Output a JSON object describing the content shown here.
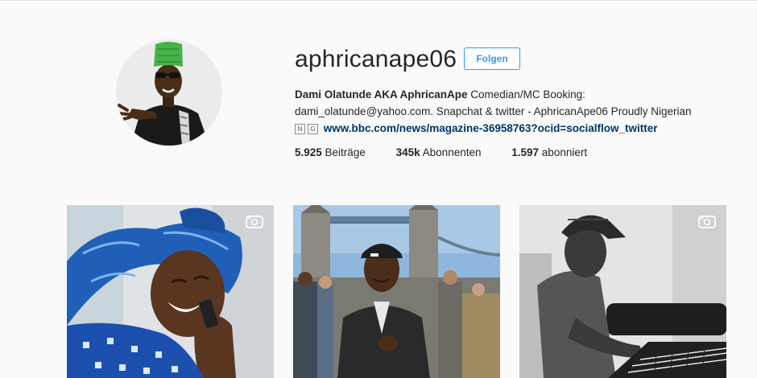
{
  "profile": {
    "username": "aphricanape06",
    "follow_label": "Folgen",
    "bio_name": "Dami Olatunde AKA AphricanApe",
    "bio_line1_rest": " Comedian/MC Booking:",
    "bio_line2": "dami_olatunde@yahoo.com. Snapchat & twitter - AphricanApe06 Proudly Nigerian",
    "bio_link": "www.bbc.com/news/magazine-36958763?ocid=socialflow_twitter",
    "bio_icons": [
      "N",
      "G"
    ]
  },
  "stats": {
    "posts_count": "5.925",
    "posts_label": " Beiträge",
    "followers_count": "345k",
    "followers_label": " Abonnenten",
    "following_count": "1.597",
    "following_label": " abonniert"
  },
  "posts": [
    {
      "type": "video",
      "icon": "video-camera-icon"
    },
    {
      "type": "photo"
    },
    {
      "type": "video",
      "icon": "video-camera-icon"
    }
  ],
  "colors": {
    "accent": "#3897f0",
    "link": "#003569",
    "background": "#fafafa"
  }
}
